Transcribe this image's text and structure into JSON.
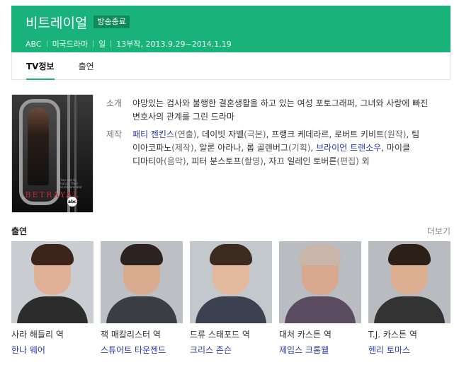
{
  "header": {
    "title": "비트레이얼",
    "badge": "방송종료",
    "meta": [
      "ABC",
      "미국드라마",
      "일",
      "13부작, 2013.9.29~2014.1.19"
    ]
  },
  "tabs": [
    {
      "label": "TV정보",
      "active": true
    },
    {
      "label": "출연",
      "active": false
    }
  ],
  "poster": {
    "title_text": "BETRAYAL",
    "network_logo": "abc",
    "tagline": "They met by chance. Their secrets are fatal."
  },
  "info": {
    "intro_label": "소개",
    "intro_text": "야망있는 검사와 불행한 결혼생활을 하고 있는 여성 포토그래퍼, 그녀와 사랑에 빠진 변호사의 관계를 그린 드라마",
    "staff_label": "제작",
    "staff": [
      {
        "name": "패티 젠킨스",
        "role": "(연출)",
        "link": true,
        "sep": ", "
      },
      {
        "name": "데이빗 자벨",
        "role": "(극본)",
        "link": false,
        "sep": ", "
      },
      {
        "name": "프랭크 케데라르",
        "role": "",
        "link": false,
        "sep": ", "
      },
      {
        "name": "로버트 키비트",
        "role": "(원작)",
        "link": false,
        "sep": ", "
      },
      {
        "name": "팀 이아코파노",
        "role": "(제작)",
        "link": false,
        "sep": ", "
      },
      {
        "name": "알론 아라나",
        "role": "",
        "link": false,
        "sep": ", "
      },
      {
        "name": "롭 골렌버그",
        "role": "(기획)",
        "link": false,
        "sep": ", "
      },
      {
        "name": "브라이언 트랜소우",
        "role": "",
        "link": true,
        "sep": ", "
      },
      {
        "name": "마이클 디마티아",
        "role": "(음악)",
        "link": false,
        "sep": ", "
      },
      {
        "name": "피터 분스토프",
        "role": "(촬영)",
        "link": false,
        "sep": ", "
      },
      {
        "name": "자끄 일레인 토버른",
        "role": "(편집)",
        "link": false,
        "sep": " "
      }
    ],
    "staff_suffix": "외"
  },
  "cast": {
    "title": "출연",
    "more_label": "더보기",
    "members": [
      {
        "role": "사라 해들리 역",
        "name": "한나 웨어",
        "bg": "#c9cdd1",
        "skin": "#e0b196",
        "hair": "#3b241a",
        "body": "#2c2c2c"
      },
      {
        "role": "잭 매칼리스터 역",
        "name": "스튜어트 타운젠드",
        "bg": "#bcc0c4",
        "skin": "#d9ab8f",
        "hair": "#2d2220",
        "body": "#3a3d44"
      },
      {
        "role": "드류 스태포드 역",
        "name": "크리스 존슨",
        "bg": "#c3c8cc",
        "skin": "#e3b99d",
        "hair": "#3a2a20",
        "body": "#3b4150"
      },
      {
        "role": "대처 카스튼 역",
        "name": "제임스 크롬웰",
        "bg": "#b9bdc1",
        "skin": "#d8a88f",
        "hair": "#c8b6aa",
        "body": "#5b4b60"
      },
      {
        "role": "T.J. 카스튼 역",
        "name": "헨리 토마스",
        "bg": "#b8bcc0",
        "skin": "#dcae92",
        "hair": "#2b1f18",
        "body": "#333333"
      }
    ]
  }
}
